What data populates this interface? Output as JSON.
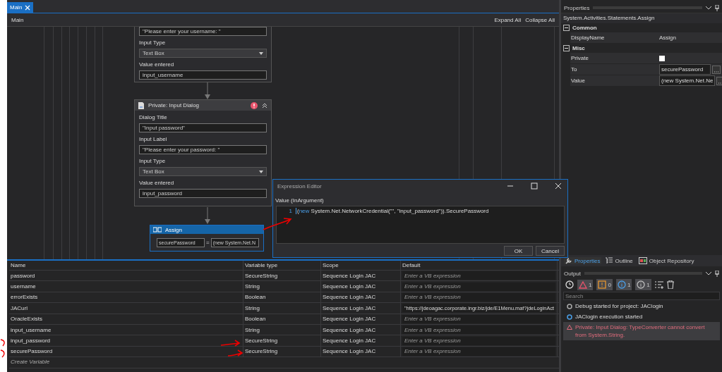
{
  "document_tabs": [
    {
      "label": "Main",
      "selected": true
    }
  ],
  "designer": {
    "breadcrumb": "Main",
    "expand_all": "Expand All",
    "collapse_all": "Collapse All",
    "first_dialog": {
      "fields": [
        {
          "kind": "text",
          "value": "\"Please enter your username: \""
        },
        {
          "kind": "dropdown",
          "label": "Input Type",
          "value": "Text Box"
        },
        {
          "kind": "text",
          "label": "Value entered",
          "value": "input_username"
        }
      ]
    },
    "second_dialog": {
      "title": "Private: Input Dialog",
      "error": true,
      "fields": [
        {
          "kind": "text",
          "label": "Dialog Title",
          "value": "\"Input password\""
        },
        {
          "kind": "text",
          "label": "Input Label",
          "value": "\"Please enter your password: \""
        },
        {
          "kind": "dropdown",
          "label": "Input Type",
          "value": "Text Box"
        },
        {
          "kind": "text",
          "label": "Value entered",
          "value": "input_password"
        }
      ]
    },
    "assign": {
      "title": "Assign",
      "selected": true,
      "to": "securePassword",
      "operator": "=",
      "value": "(new System.Net.N"
    }
  },
  "expression_editor": {
    "title": "Expression Editor",
    "label": "Value (InArgument)",
    "lines": [
      {
        "number": "1",
        "prefix": "(",
        "keyword": "new",
        "code": " System.Net.NetworkCredential(\"\", \"input_password\")).SecurePassword"
      }
    ],
    "buttons": [
      "OK",
      "Cancel"
    ]
  },
  "variables": {
    "columns": [
      "Name",
      "Variable type",
      "Scope",
      "Default"
    ],
    "rows": [
      {
        "name": "password",
        "type": "SecureString",
        "scope": "Sequence Login JAC",
        "placeholder": "Enter a VB expression"
      },
      {
        "name": "username",
        "type": "String",
        "scope": "Sequence Login JAC",
        "placeholder": "Enter a VB expression"
      },
      {
        "name": "errorExists",
        "type": "Boolean",
        "scope": "Sequence Login JAC",
        "placeholder": "Enter a VB expression"
      },
      {
        "name": "JACurl",
        "type": "String",
        "scope": "Sequence Login JAC",
        "value": "\"https://jdeoagac.corporate.ingr.biz/jde/E1Menu.maf?jdeLoginAct"
      },
      {
        "name": "OracleExists",
        "type": "Boolean",
        "scope": "Sequence Login JAC",
        "placeholder": "Enter a VB expression"
      },
      {
        "name": "input_username",
        "type": "String",
        "scope": "Sequence Login JAC",
        "placeholder": "Enter a VB expression"
      },
      {
        "name": "input_password",
        "type": "SecureString",
        "scope": "Sequence Login JAC",
        "placeholder": "Enter a VB expression"
      },
      {
        "name": "securePassword",
        "type": "SecureString",
        "scope": "Sequence Login JAC",
        "placeholder": "Enter a VB expression"
      }
    ],
    "create": "Create Variable"
  },
  "properties": {
    "title": "Properties",
    "type_name": "System.Activities.Statements.Assign",
    "categories": [
      {
        "name": "Common",
        "expanded": true,
        "rows": [
          {
            "name": "DisplayName",
            "kind": "text",
            "value": "Assign"
          }
        ]
      },
      {
        "name": "Misc",
        "expanded": true,
        "rows": [
          {
            "name": "Private",
            "kind": "checkbox",
            "checked": false
          },
          {
            "name": "To",
            "kind": "field",
            "value": "securePassword"
          },
          {
            "name": "Value",
            "kind": "field",
            "value": "(new System.Net.Ne"
          }
        ]
      }
    ]
  },
  "panel_tabs": [
    {
      "label": "Properties",
      "selected": true
    },
    {
      "label": "Outline",
      "selected": false
    },
    {
      "label": "Object Repository",
      "selected": false
    }
  ],
  "output": {
    "title": "Output",
    "filters": [
      {
        "kind": "error",
        "count": "1"
      },
      {
        "kind": "warning",
        "count": "0"
      },
      {
        "kind": "info",
        "count": "1"
      },
      {
        "kind": "trace",
        "count": "1"
      }
    ],
    "search_placeholder": "Search",
    "entries": [
      {
        "kind": "trace",
        "text": "Debug started for project: JAClogin",
        "selected": false
      },
      {
        "kind": "info",
        "text": "JAClogin execution started",
        "selected": false
      },
      {
        "kind": "error",
        "text": "Private: Input Dialog: TypeConverter cannot convert from System.String.",
        "selected": true
      }
    ]
  }
}
